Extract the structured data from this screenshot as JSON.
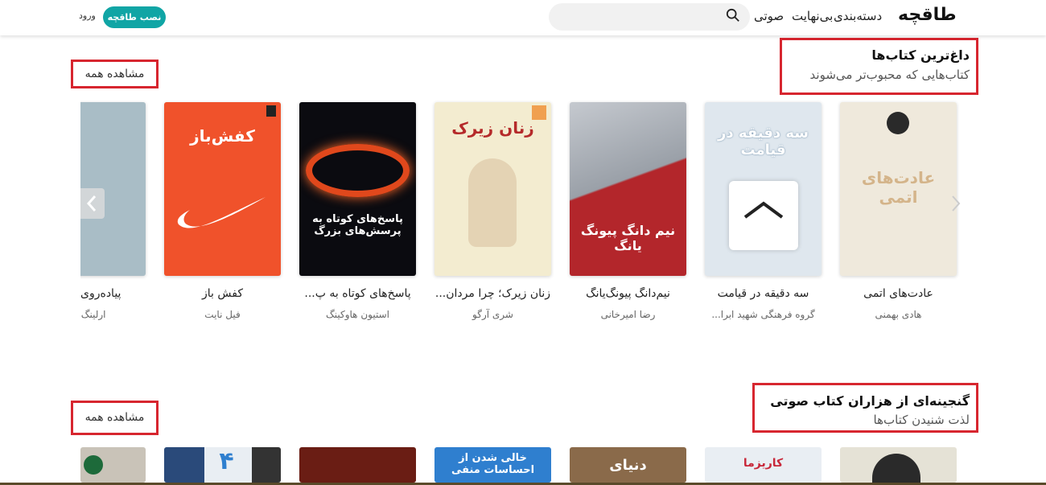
{
  "header": {
    "logo": "طاقچه",
    "nav": [
      "دسته‌بندی",
      "بی‌نهایت",
      "صوتی"
    ],
    "search_placeholder": "",
    "install_label": "نصب طاقچه",
    "login_label": "ورود"
  },
  "section1": {
    "title": "داغ‌ترین کتاب‌ها",
    "subtitle": "کتاب‌هایی که محبوب‌تر می‌شوند",
    "see_all": "مشاهده همه",
    "books": [
      {
        "title": "عادت‌های اتمی",
        "author": "هادی بهمنی",
        "cover_color": "#efe9dc",
        "cover_text": "عادت‌های اتمی"
      },
      {
        "title": "سه دقیقه در قیامت",
        "author": "گروه فرهنگی شهید ابرا...",
        "cover_color": "#dfe7ee",
        "cover_text": "سه دقیقه در قیامت"
      },
      {
        "title": "نیم‌دانگ پیونگ‌یانگ",
        "author": "رضا امیرخانی",
        "cover_color": "#b3262b",
        "cover_text": "نیم دانگ پیونگ یانگ"
      },
      {
        "title": "زنان زیرک؛ چرا مردان...",
        "author": "شری آرگو",
        "cover_color": "#f3ecd0",
        "cover_text": "زنان زیرک"
      },
      {
        "title": "پاسخ‌های کوتاه به پ...",
        "author": "استیون هاوکینگ",
        "cover_color": "#0b0b10",
        "cover_text": "پاسخ‌های کوتاه به پرسش‌های بزرگ"
      },
      {
        "title": "کفش باز",
        "author": "فیل نایت",
        "cover_color": "#f0522b",
        "cover_text": "کفش‌باز"
      },
      {
        "title": "پیاده‌روی؛ و ...",
        "author": "ارلینگ ...",
        "cover_color": "#a9bdc6",
        "cover_text": ""
      }
    ]
  },
  "section2": {
    "title": "گنجینه‌ای از هزاران کتاب صوتی",
    "subtitle": "لذت شنیدن کتاب‌ها",
    "see_all": "مشاهده همه",
    "books": [
      {
        "cover_color": "#c9c3b8",
        "cover_text": ""
      },
      {
        "cover_color": "#d9d9dc",
        "cover_text": "کاریزما"
      },
      {
        "cover_color": "#8a6a4a",
        "cover_text": "دنیای"
      },
      {
        "cover_color": "#2f7fcf",
        "cover_text": "خالی شدن از احساسات منفی"
      },
      {
        "cover_color": "#6a1d14",
        "cover_text": ""
      },
      {
        "cover_color": "#e9eef3",
        "cover_text": "۴"
      },
      {
        "cover_color": "#e5e2d6",
        "cover_text": ""
      }
    ]
  }
}
